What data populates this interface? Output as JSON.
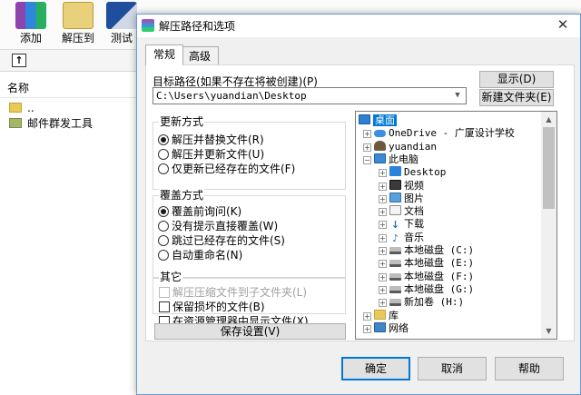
{
  "app": {
    "toolbar": [
      {
        "label": "添加",
        "icon": "add-archive-icon"
      },
      {
        "label": "解压到",
        "icon": "extract-to-icon"
      },
      {
        "label": "测试",
        "icon": "test-icon"
      }
    ],
    "list_header": "名称",
    "files": [
      {
        "name": ".."
      },
      {
        "name": "邮件群发工具"
      }
    ]
  },
  "dialog": {
    "title": "解压路径和选项",
    "close_glyph": "✕",
    "tabs": [
      {
        "label": "常规",
        "active": true
      },
      {
        "label": "高级",
        "active": false
      }
    ],
    "target_path_label": "目标路径(如果不存在将被创建)(P)",
    "target_path_value": "C:\\Users\\yuandian\\Desktop",
    "show_button": "显示(D)",
    "new_folder_button": "新建文件夹(E)",
    "update_mode": {
      "title": "更新方式",
      "options": [
        {
          "label": "解压并替换文件(R)",
          "selected": true
        },
        {
          "label": "解压并更新文件(U)",
          "selected": false
        },
        {
          "label": "仅更新已经存在的文件(F)",
          "selected": false
        }
      ]
    },
    "overwrite_mode": {
      "title": "覆盖方式",
      "options": [
        {
          "label": "覆盖前询问(K)",
          "selected": true
        },
        {
          "label": "没有提示直接覆盖(W)",
          "selected": false
        },
        {
          "label": "跳过已经存在的文件(S)",
          "selected": false
        },
        {
          "label": "自动重命名(N)",
          "selected": false
        }
      ]
    },
    "other": {
      "title": "其它",
      "options": [
        {
          "label": "解压压缩文件到子文件夹(L)",
          "checked": false,
          "disabled": true
        },
        {
          "label": "保留损坏的文件(B)",
          "checked": false,
          "disabled": false
        },
        {
          "label": "在资源管理器中显示文件(X)",
          "checked": false,
          "disabled": false
        }
      ]
    },
    "save_settings_button": "保存设置(V)",
    "tree": [
      {
        "label": "桌面",
        "icon": "desktop-icon",
        "expander": "",
        "selected": true
      },
      {
        "label": "OneDrive - 广厦设计学校",
        "icon": "onedrive-icon",
        "expander": "+"
      },
      {
        "label": "yuandian",
        "icon": "user-folder-icon",
        "expander": "+"
      },
      {
        "label": "此电脑",
        "icon": "this-pc-icon",
        "expander": "-"
      },
      {
        "label": "Desktop",
        "icon": "desktop-folder-icon",
        "expander": "+"
      },
      {
        "label": "视频",
        "icon": "videos-icon",
        "expander": "+"
      },
      {
        "label": "图片",
        "icon": "pictures-icon",
        "expander": "+"
      },
      {
        "label": "文档",
        "icon": "documents-icon",
        "expander": "+"
      },
      {
        "label": "下载",
        "icon": "downloads-icon",
        "expander": "+"
      },
      {
        "label": "音乐",
        "icon": "music-icon",
        "expander": "+"
      },
      {
        "label": "本地磁盘 (C:)",
        "icon": "disk-c-icon",
        "expander": "+"
      },
      {
        "label": "本地磁盘 (E:)",
        "icon": "disk-e-icon",
        "expander": "+"
      },
      {
        "label": "本地磁盘 (F:)",
        "icon": "disk-f-icon",
        "expander": "+"
      },
      {
        "label": "本地磁盘 (G:)",
        "icon": "disk-g-icon",
        "expander": "+"
      },
      {
        "label": "新加卷 (H:)",
        "icon": "disk-h-icon",
        "expander": "+"
      },
      {
        "label": "库",
        "icon": "libraries-icon",
        "expander": "+"
      },
      {
        "label": "网络",
        "icon": "network-icon",
        "expander": "+"
      }
    ],
    "buttons": {
      "ok": "确定",
      "cancel": "取消",
      "help": "帮助"
    }
  }
}
